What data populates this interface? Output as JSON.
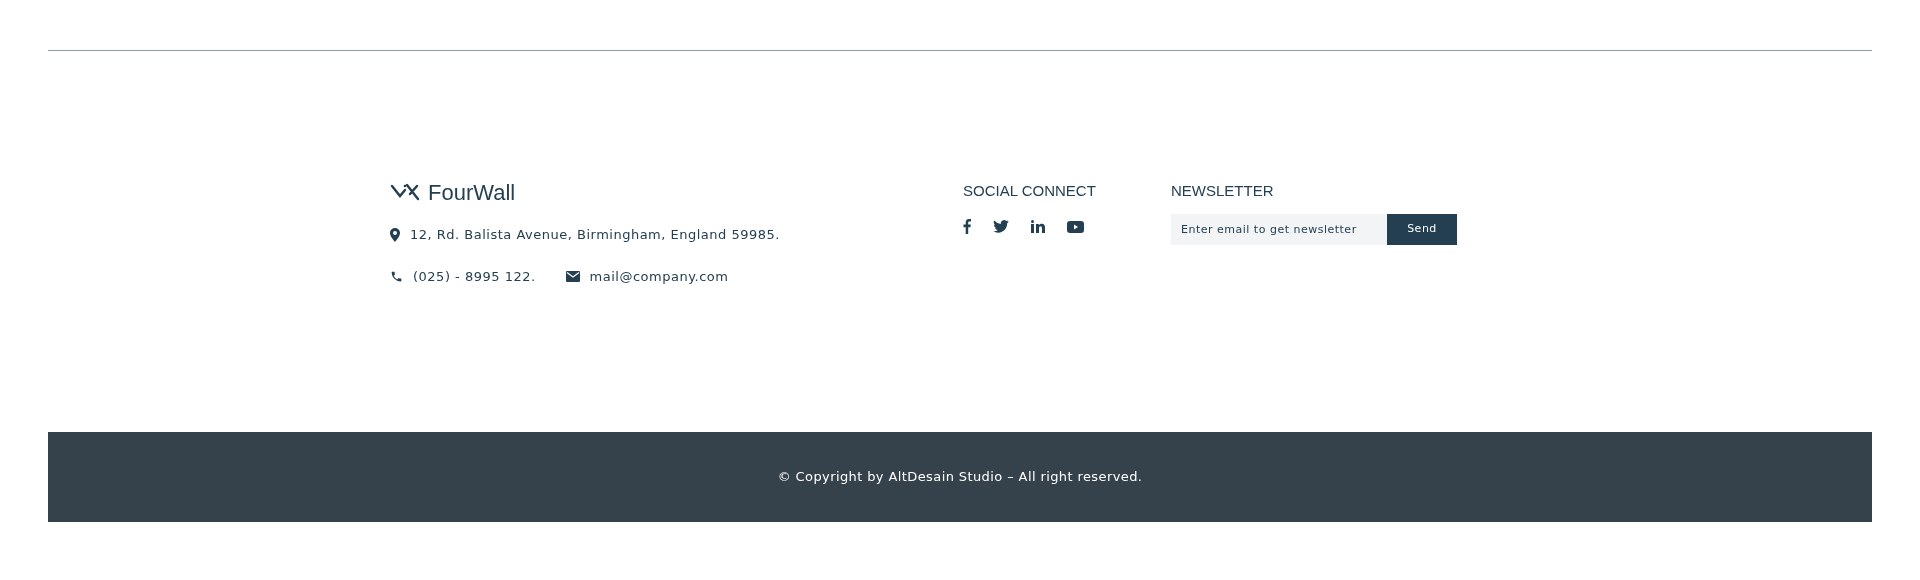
{
  "brand": {
    "name": "FourWall"
  },
  "contact": {
    "address": "12, Rd. Balista Avenue, Birmingham, England 59985.",
    "phone": "(025) - 8995 122.",
    "email": "mail@company.com"
  },
  "social": {
    "title": "SOCIAL CONNECT",
    "links": [
      {
        "kind": "facebook"
      },
      {
        "kind": "twitter"
      },
      {
        "kind": "linkedin"
      },
      {
        "kind": "youtube"
      }
    ]
  },
  "newsletter": {
    "title": "NEWSLETTER",
    "placeholder": "Enter email to get newsletter",
    "button": "Send"
  },
  "copyright": "© Copyright by AltDesain Studio – All right reserved."
}
